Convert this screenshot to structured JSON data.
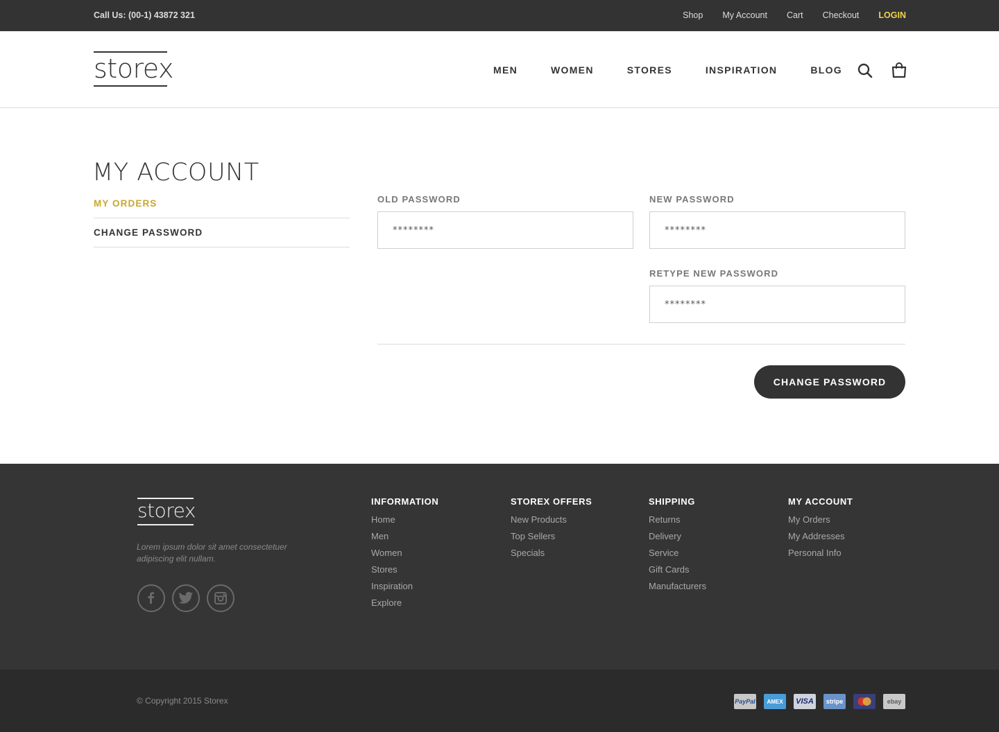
{
  "topbar": {
    "call": "Call Us: (00-1) 43872 321",
    "links": [
      "Shop",
      "My Account",
      "Cart",
      "Checkout"
    ],
    "login": "LOGIN"
  },
  "header": {
    "logo": "storex",
    "nav": [
      "MEN",
      "WOMEN",
      "STORES",
      "INSPIRATION",
      "BLOG"
    ],
    "icons": [
      "search-icon",
      "shopping-bag-icon"
    ]
  },
  "main": {
    "title": "MY ACCOUNT",
    "sidebar": [
      {
        "label": "MY ORDERS",
        "active": true
      },
      {
        "label": "CHANGE PASSWORD",
        "active": false
      }
    ],
    "form": {
      "old_password": {
        "label": "OLD PASSWORD",
        "value": "********"
      },
      "new_password": {
        "label": "NEW PASSWORD",
        "value": "********"
      },
      "retype_password": {
        "label": "RETYPE NEW PASSWORD",
        "value": "********"
      },
      "submit": "CHANGE PASSWORD"
    }
  },
  "footer": {
    "logo": "storex",
    "text": "Lorem ipsum dolor sit amet consectetuer adipiscing elit nullam.",
    "social": [
      "facebook-icon",
      "twitter-icon",
      "instagram-icon"
    ],
    "columns": [
      {
        "heading": "INFORMATION",
        "links": [
          "Home",
          "Men",
          "Women",
          "Stores",
          "Inspiration",
          "Explore"
        ]
      },
      {
        "heading": "STOREX OFFERS",
        "links": [
          "New Products",
          "Top Sellers",
          "Specials"
        ]
      },
      {
        "heading": "SHIPPING",
        "links": [
          "Returns",
          "Delivery",
          "Service",
          "Gift Cards",
          "Manufacturers"
        ]
      },
      {
        "heading": "MY ACCOUNT",
        "links": [
          "My Orders",
          "My Addresses",
          "Personal Info"
        ]
      }
    ],
    "copyright": "© Copyright 2015 Storex",
    "payments": [
      {
        "name": "PayPal",
        "color": "#c8c8c8"
      },
      {
        "name": "AMEX",
        "color": "#4a9cd6"
      },
      {
        "name": "VISA",
        "color": "#cfd3dc"
      },
      {
        "name": "stripe",
        "color": "#6a93c9"
      },
      {
        "name": "mastercard",
        "color": "#3a3f78"
      },
      {
        "name": "ebay",
        "color": "#c9c9c9"
      }
    ]
  },
  "colors": {
    "accent": "#c8a82c",
    "login": "#f0d24a",
    "dark": "#333333",
    "footer": "#353535",
    "bottom": "#2b2b2b"
  }
}
